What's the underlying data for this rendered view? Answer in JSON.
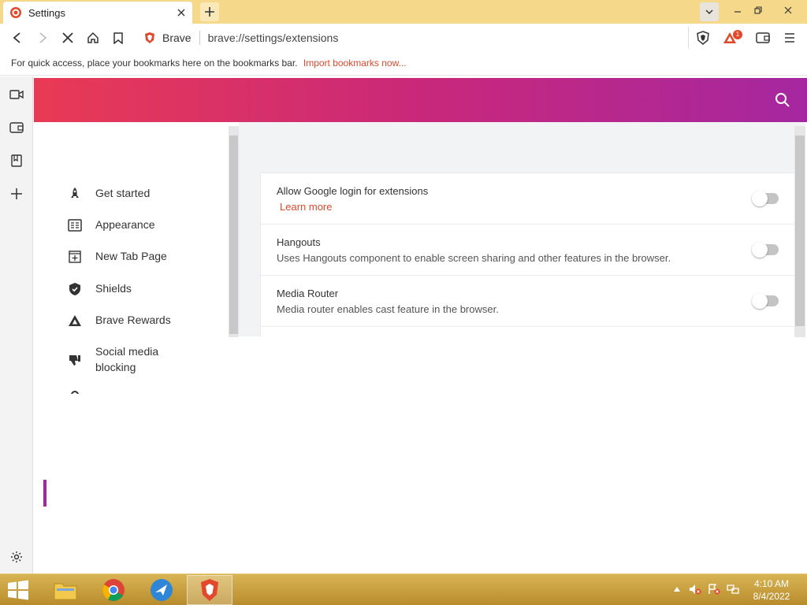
{
  "browser": {
    "tab_title": "Settings",
    "omnibox_label": "Brave",
    "url": "brave://settings/extensions",
    "notification_count": "1"
  },
  "bookmarks_bar": {
    "message": "For quick access, place your bookmarks here on the bookmarks bar.",
    "import_link": "Import bookmarks now..."
  },
  "settings_nav": {
    "items": [
      {
        "label": "Get started",
        "icon": "rocket-icon"
      },
      {
        "label": "Appearance",
        "icon": "appearance-icon"
      },
      {
        "label": "New Tab Page",
        "icon": "new-tab-icon"
      },
      {
        "label": "Shields",
        "icon": "shield-icon"
      },
      {
        "label": "Brave Rewards",
        "icon": "rewards-triangle-icon"
      },
      {
        "label": "Social media blocking",
        "icon": "thumbs-down-icon"
      }
    ]
  },
  "extensions": {
    "rows": [
      {
        "title": "Allow Google login for extensions",
        "link": "Learn more",
        "enabled": false
      },
      {
        "title": "Hangouts",
        "description": "Uses Hangouts component to enable screen sharing and other features in the browser.",
        "enabled": false
      },
      {
        "title": "Media Router",
        "description": "Media router enables cast feature in the browser.",
        "enabled": false
      }
    ]
  },
  "taskbar": {
    "time": "4:10 AM",
    "date": "8/4/2022"
  },
  "colors": {
    "accent": "#e2492c",
    "header_gradient_start": "#e93a54",
    "header_gradient_end": "#a527a0",
    "tabstrip": "#f6d88a"
  }
}
